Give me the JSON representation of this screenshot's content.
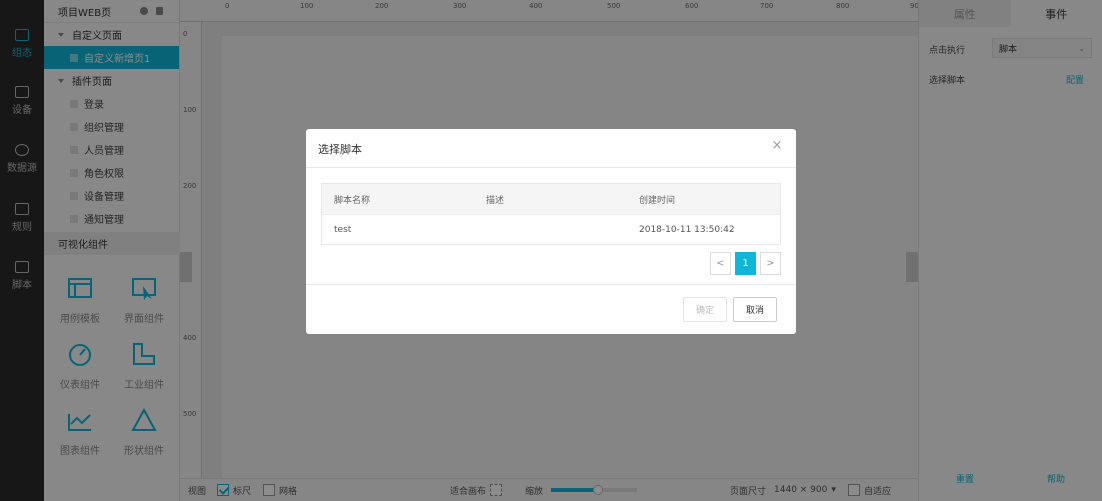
{
  "nav": [
    {
      "label": "组态",
      "icon": "layers-icon",
      "active": true
    },
    {
      "label": "设备",
      "icon": "device-icon",
      "active": false
    },
    {
      "label": "数据源",
      "icon": "cube-icon",
      "active": false
    },
    {
      "label": "规则",
      "icon": "rule-icon",
      "active": false
    },
    {
      "label": "脚本",
      "icon": "script-icon",
      "active": false
    }
  ],
  "tree": {
    "title": "项目WEB页",
    "groups": [
      {
        "label": "自定义页面",
        "items": [
          "自定义新增页1"
        ]
      },
      {
        "label": "插件页面",
        "items": [
          "登录",
          "组织管理",
          "人员管理",
          "角色权限",
          "设备管理",
          "通知管理"
        ]
      }
    ],
    "components_title": "可视化组件",
    "components": [
      "用例模板",
      "界面组件",
      "仪表组件",
      "工业组件",
      "图表组件",
      "形状组件"
    ]
  },
  "ruler": {
    "top": [
      "0",
      "100",
      "200",
      "300",
      "400",
      "500",
      "600",
      "700",
      "800",
      "90"
    ],
    "left": [
      "0",
      "100",
      "200",
      "400",
      "500"
    ]
  },
  "modal": {
    "title": "选择脚本",
    "close": "×",
    "columns": [
      "脚本名称",
      "描述",
      "创建时间"
    ],
    "rows": [
      {
        "name": "test",
        "desc": "",
        "created": "2018-10-11 13:50:42"
      }
    ],
    "pager": {
      "prev": "<",
      "current": "1",
      "next": ">"
    },
    "confirm": "确定",
    "cancel": "取消"
  },
  "right_panel": {
    "tabs": [
      "属性",
      "事件"
    ],
    "click_label": "点击执行",
    "click_value": "脚本",
    "script_label": "选择脚本",
    "config_link": "配置",
    "reset": "重置",
    "help": "帮助"
  },
  "bottom": {
    "view": "视图",
    "ruler": "标尺",
    "ruler_checked": true,
    "grid": "网格",
    "grid_checked": false,
    "fit": "适合画布",
    "zoom": "缩放",
    "zoom_fraction": 0.55,
    "page_size_label": "页面尺寸",
    "page_size_value": "1440 × 900",
    "auto": "自适应",
    "auto_checked": false
  },
  "colors": {
    "accent": "#10b5d8"
  }
}
